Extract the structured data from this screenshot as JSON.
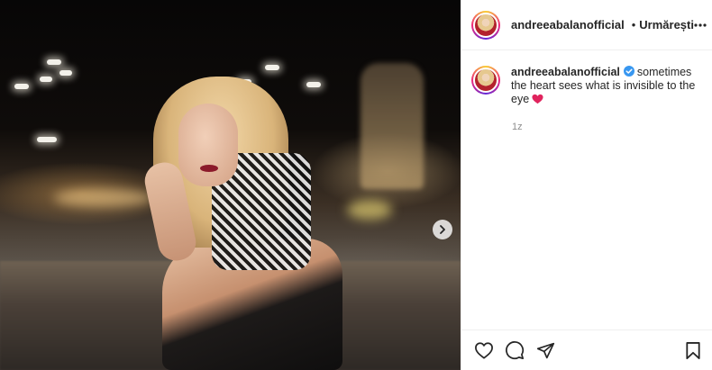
{
  "post": {
    "username": "andreeabalanofficial",
    "verified": true,
    "follow_label": "Urmărești",
    "separator": "•",
    "caption_text": "sometimes the heart sees what is invisible to the eye",
    "caption_emoji": "red-heart",
    "timestamp": "1z"
  },
  "icons": {
    "more": "more-horizontal-icon",
    "next": "chevron-right-icon",
    "like": "heart-outline-icon",
    "comment": "comment-bubble-icon",
    "share": "paper-plane-icon",
    "save": "bookmark-icon",
    "verified": "verified-badge-icon"
  },
  "colors": {
    "verified_blue": "#3897f0",
    "heart_red": "#e0245e",
    "text": "#262626",
    "secondary_text": "#8e8e8e"
  }
}
